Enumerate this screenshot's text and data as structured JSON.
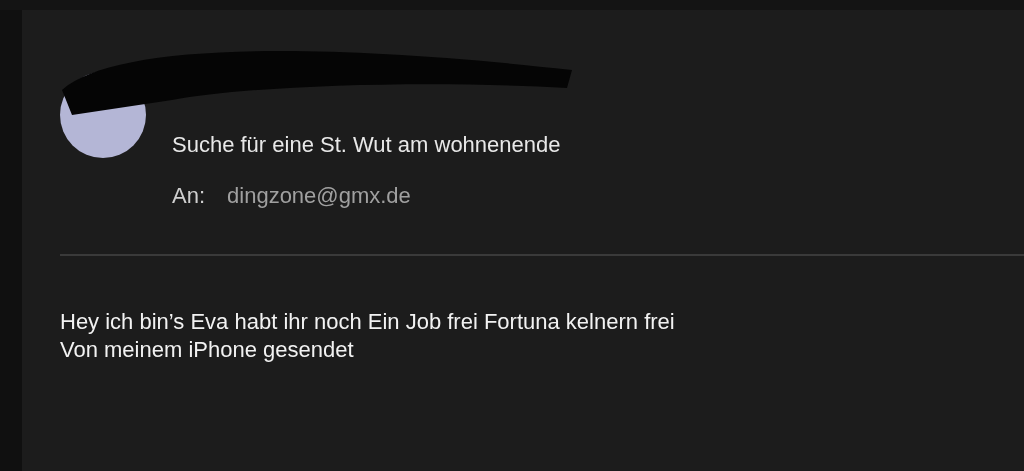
{
  "message": {
    "subject": "Suche für eine St. Wut am wohnenende",
    "recipient_label": "An:",
    "recipient": "dingzone@gmx.de",
    "body": [
      "Hey ich bin’s Eva habt ihr noch Ein Job frei Fortuna kelnern frei",
      "Von meinem iPhone gesendet"
    ]
  }
}
